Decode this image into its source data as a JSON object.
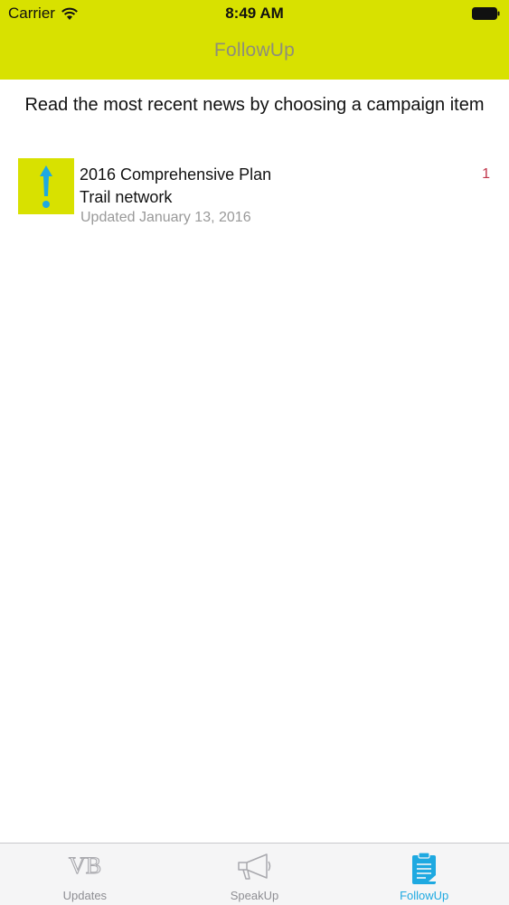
{
  "status_bar": {
    "carrier": "Carrier",
    "time": "8:49 AM"
  },
  "nav": {
    "title": "FollowUp"
  },
  "main": {
    "intro": "Read the most recent news by choosing a campaign item",
    "items": [
      {
        "title_line1": "2016 Comprehensive Plan",
        "title_line2": "Trail network",
        "updated": "Updated January 13, 2016",
        "count": "1",
        "icon": "exclamation-icon"
      }
    ]
  },
  "tab_bar": {
    "tabs": [
      {
        "label": "Updates",
        "icon": "vb-logo-icon",
        "active": false
      },
      {
        "label": "SpeakUp",
        "icon": "megaphone-icon",
        "active": false
      },
      {
        "label": "FollowUp",
        "icon": "clipboard-icon",
        "active": true
      }
    ]
  },
  "colors": {
    "brand": "#d8e100",
    "accent": "#1ea9e1",
    "count": "#c0354a"
  }
}
